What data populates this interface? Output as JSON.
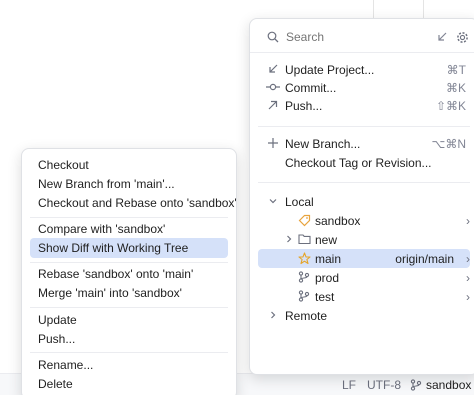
{
  "branch_popup": {
    "search_placeholder": "Search",
    "actions": [
      {
        "label": "Update Project...",
        "shortcut": "⌘T",
        "icon": "update-arrow-icon"
      },
      {
        "label": "Commit...",
        "shortcut": "⌘K",
        "icon": "commit-icon"
      },
      {
        "label": "Push...",
        "shortcut": "⇧⌘K",
        "icon": "push-arrow-icon"
      }
    ],
    "actions2": [
      {
        "label": "New Branch...",
        "shortcut": "⌥⌘N",
        "icon": "plus-icon"
      },
      {
        "label": "Checkout Tag or Revision...",
        "shortcut": "",
        "icon": ""
      }
    ],
    "local_group": "Local",
    "local_branches": [
      {
        "label": "sandbox",
        "icon": "tag-icon",
        "remote": "",
        "has_submenu": true,
        "selected": false
      },
      {
        "label": "new",
        "icon": "folder-icon",
        "remote": "",
        "has_submenu": false,
        "selected": false,
        "expandable": true
      },
      {
        "label": "main",
        "icon": "star-icon",
        "remote": "origin/main",
        "has_submenu": true,
        "selected": true
      },
      {
        "label": "prod",
        "icon": "branch-icon",
        "remote": "",
        "has_submenu": true,
        "selected": false
      },
      {
        "label": "test",
        "icon": "branch-icon",
        "remote": "",
        "has_submenu": true,
        "selected": false
      }
    ],
    "remote_group": "Remote"
  },
  "context_menu": {
    "groups": [
      [
        "Checkout",
        "New Branch from 'main'...",
        "Checkout and Rebase onto 'sandbox'"
      ],
      [
        "Compare with 'sandbox'",
        "Show Diff with Working Tree"
      ],
      [
        "Rebase 'sandbox' onto 'main'",
        "Merge 'main' into 'sandbox'"
      ],
      [
        "Update",
        "Push..."
      ],
      [
        "Rename...",
        "Delete"
      ]
    ],
    "selected": "Show Diff with Working Tree"
  },
  "status_bar": {
    "line_separator": "LF",
    "encoding": "UTF-8",
    "branch": "sandbox"
  },
  "colors": {
    "selection": "#d5e1f9",
    "star": "#e5a52a",
    "tag": "#e8a33d"
  }
}
